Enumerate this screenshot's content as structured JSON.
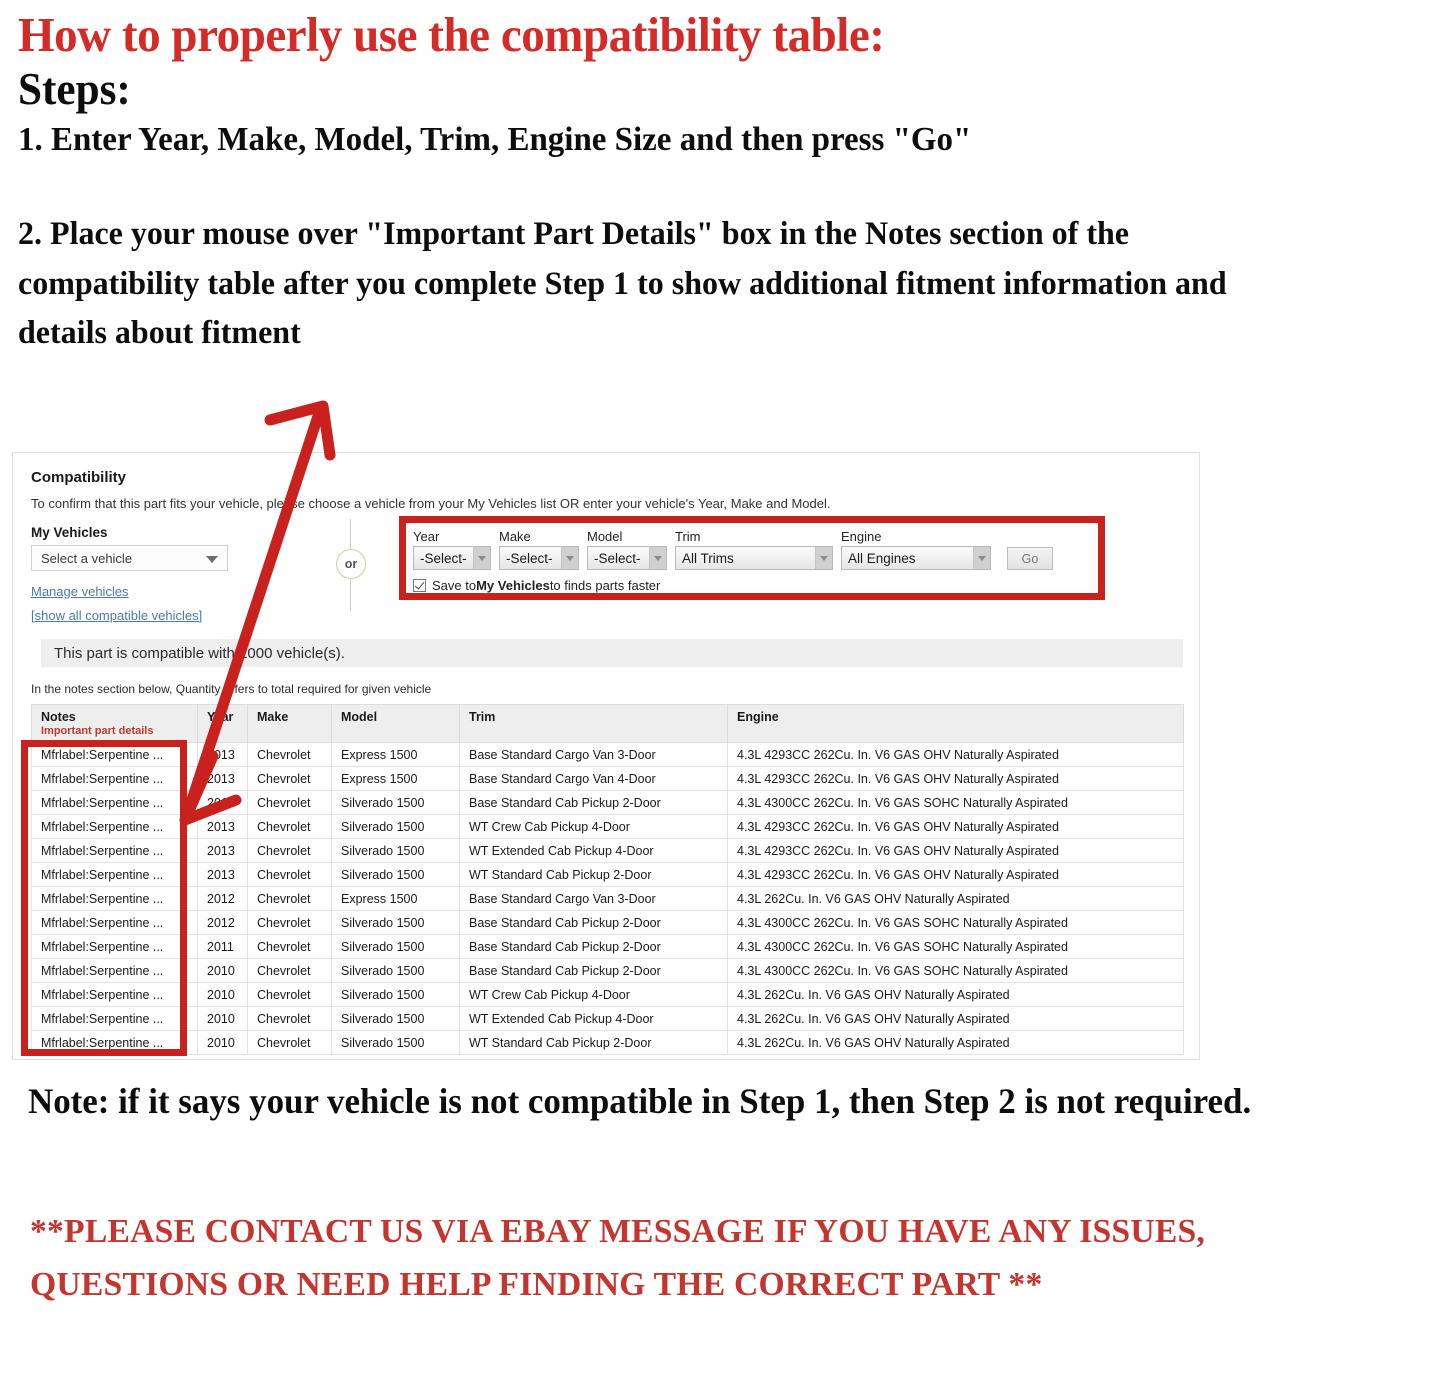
{
  "instructions": {
    "headline": "How to properly use the compatibility table:",
    "steps_label": "Steps:",
    "step_one": "1. Enter Year, Make, Model, Trim, Engine Size and then press \"Go\"",
    "step_two": "2. Place your mouse over \"Important Part Details\" box in the Notes section of the compatibility table after you complete Step 1 to show additional fitment information and details about fitment"
  },
  "compatibility": {
    "title": "Compatibility",
    "subtitle": "To confirm that this part fits your vehicle, please choose a vehicle from your My Vehicles list OR enter your vehicle's Year, Make and Model.",
    "my_vehicles": {
      "label": "My Vehicles",
      "selected": "Select a vehicle",
      "manage_link": "Manage vehicles",
      "show_all_link": "[show all compatible vehicles]"
    },
    "or_label": "or",
    "finder": {
      "year_label": "Year",
      "year_value": "-Select-",
      "make_label": "Make",
      "make_value": "-Select-",
      "model_label": "Model",
      "model_value": "-Select-",
      "trim_label": "Trim",
      "trim_value": "All Trims",
      "engine_label": "Engine",
      "engine_value": "All Engines",
      "go_label": "Go",
      "save_prefix": "Save to ",
      "save_bold": "My Vehicles",
      "save_suffix": " to finds parts faster"
    },
    "banner": "This part is compatible with 1000 vehicle(s).",
    "notes_hint": "In the notes section below, Quantity refers to total required for given vehicle",
    "table": {
      "headers": {
        "notes": "Notes",
        "notes_sub": "Important part details",
        "year": "Year",
        "make": "Make",
        "model": "Model",
        "trim": "Trim",
        "engine": "Engine"
      },
      "rows": [
        {
          "notes": "Mfrlabel:Serpentine ...",
          "year": "2013",
          "make": "Chevrolet",
          "model": "Express 1500",
          "trim": "Base Standard Cargo Van 3-Door",
          "engine": "4.3L 4293CC 262Cu. In. V6 GAS OHV Naturally Aspirated"
        },
        {
          "notes": "Mfrlabel:Serpentine ...",
          "year": "2013",
          "make": "Chevrolet",
          "model": "Express 1500",
          "trim": "Base Standard Cargo Van 4-Door",
          "engine": "4.3L 4293CC 262Cu. In. V6 GAS OHV Naturally Aspirated"
        },
        {
          "notes": "Mfrlabel:Serpentine ...",
          "year": "2013",
          "make": "Chevrolet",
          "model": "Silverado 1500",
          "trim": "Base Standard Cab Pickup 2-Door",
          "engine": "4.3L 4300CC 262Cu. In. V6 GAS SOHC Naturally Aspirated"
        },
        {
          "notes": "Mfrlabel:Serpentine ...",
          "year": "2013",
          "make": "Chevrolet",
          "model": "Silverado 1500",
          "trim": "WT Crew Cab Pickup 4-Door",
          "engine": "4.3L 4293CC 262Cu. In. V6 GAS OHV Naturally Aspirated"
        },
        {
          "notes": "Mfrlabel:Serpentine ...",
          "year": "2013",
          "make": "Chevrolet",
          "model": "Silverado 1500",
          "trim": "WT Extended Cab Pickup 4-Door",
          "engine": "4.3L 4293CC 262Cu. In. V6 GAS OHV Naturally Aspirated"
        },
        {
          "notes": "Mfrlabel:Serpentine ...",
          "year": "2013",
          "make": "Chevrolet",
          "model": "Silverado 1500",
          "trim": "WT Standard Cab Pickup 2-Door",
          "engine": "4.3L 4293CC 262Cu. In. V6 GAS OHV Naturally Aspirated"
        },
        {
          "notes": "Mfrlabel:Serpentine ...",
          "year": "2012",
          "make": "Chevrolet",
          "model": "Express 1500",
          "trim": "Base Standard Cargo Van 3-Door",
          "engine": "4.3L 262Cu. In. V6 GAS OHV Naturally Aspirated"
        },
        {
          "notes": "Mfrlabel:Serpentine ...",
          "year": "2012",
          "make": "Chevrolet",
          "model": "Silverado 1500",
          "trim": "Base Standard Cab Pickup 2-Door",
          "engine": "4.3L 4300CC 262Cu. In. V6 GAS SOHC Naturally Aspirated"
        },
        {
          "notes": "Mfrlabel:Serpentine ...",
          "year": "2011",
          "make": "Chevrolet",
          "model": "Silverado 1500",
          "trim": "Base Standard Cab Pickup 2-Door",
          "engine": "4.3L 4300CC 262Cu. In. V6 GAS SOHC Naturally Aspirated"
        },
        {
          "notes": "Mfrlabel:Serpentine ...",
          "year": "2010",
          "make": "Chevrolet",
          "model": "Silverado 1500",
          "trim": "Base Standard Cab Pickup 2-Door",
          "engine": "4.3L 4300CC 262Cu. In. V6 GAS SOHC Naturally Aspirated"
        },
        {
          "notes": "Mfrlabel:Serpentine ...",
          "year": "2010",
          "make": "Chevrolet",
          "model": "Silverado 1500",
          "trim": "WT Crew Cab Pickup 4-Door",
          "engine": "4.3L 262Cu. In. V6 GAS OHV Naturally Aspirated"
        },
        {
          "notes": "Mfrlabel:Serpentine ...",
          "year": "2010",
          "make": "Chevrolet",
          "model": "Silverado 1500",
          "trim": "WT Extended Cab Pickup 4-Door",
          "engine": "4.3L 262Cu. In. V6 GAS OHV Naturally Aspirated"
        },
        {
          "notes": "Mfrlabel:Serpentine ...",
          "year": "2010",
          "make": "Chevrolet",
          "model": "Silverado 1500",
          "trim": "WT Standard Cab Pickup 2-Door",
          "engine": "4.3L 262Cu. In. V6 GAS OHV Naturally Aspirated"
        }
      ]
    }
  },
  "bottom": {
    "note": "Note: if it says your vehicle is not compatible in Step 1, then Step 2 is not required.",
    "contact": "**PLEASE CONTACT US VIA EBAY MESSAGE IF YOU HAVE ANY ISSUES, QUESTIONS OR NEED HELP FINDING THE CORRECT PART **"
  },
  "colors": {
    "headline_red": "#D52B28",
    "highlight_red": "#C9211E",
    "contact_red": "#C5352F",
    "link_blue": "#4a7ba6",
    "notes_sub_red": "#C0392B"
  }
}
